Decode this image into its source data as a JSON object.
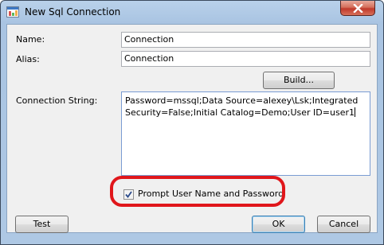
{
  "window": {
    "title": "New Sql Connection"
  },
  "form": {
    "name_label": "Name:",
    "name_value": "Connection",
    "alias_label": "Alias:",
    "alias_value": "Connection",
    "build_button": "Build...",
    "connection_string_label": "Connection String:",
    "connection_string_value": "Password=mssql;Data Source=alexey\\Lsk;Integrated Security=False;Initial Catalog=Demo;User ID=user1",
    "prompt_checkbox_label": "Prompt User Name and Password",
    "prompt_checkbox_checked": true
  },
  "footer": {
    "test_button": "Test",
    "ok_button": "OK",
    "cancel_button": "Cancel"
  },
  "colors": {
    "highlight": "#e0161b",
    "close_button": "#c0392b",
    "titlebar": "#b9d1ea"
  }
}
